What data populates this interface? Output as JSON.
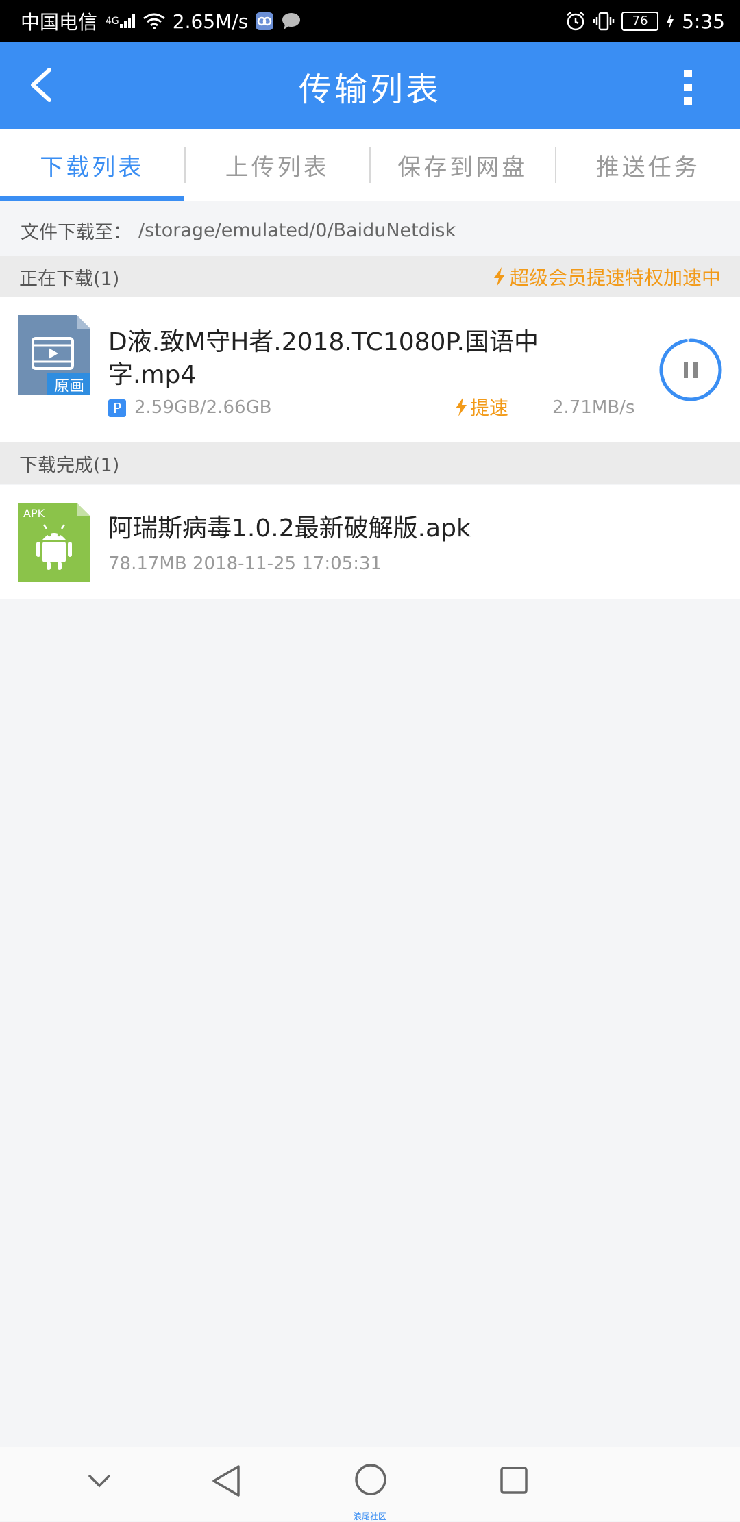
{
  "status_bar": {
    "carrier": "中国电信",
    "net_badge": "4G",
    "net_speed": "2.65M/s",
    "battery": "76",
    "time": "5:35"
  },
  "header": {
    "title": "传输列表"
  },
  "tabs": [
    {
      "label": "下载列表",
      "active": true
    },
    {
      "label": "上传列表",
      "active": false
    },
    {
      "label": "保存到网盘",
      "active": false
    },
    {
      "label": "推送任务",
      "active": false
    }
  ],
  "download_path": {
    "label": "文件下载至：",
    "path": "/storage/emulated/0/BaiduNetdisk"
  },
  "downloading": {
    "header": "正在下载(1)",
    "vip_text": "超级会员提速特权加速中",
    "items": [
      {
        "name_line1": "D液.致M守H者.2018.TC1080P.国语中",
        "name_line2": "字.mp4",
        "badge": "P",
        "progress": "2.59GB/2.66GB",
        "thumb_tag": "原画",
        "speedup_label": "提速",
        "speed": "2.71MB/s",
        "progress_fraction": 0.974
      }
    ]
  },
  "completed": {
    "header": "下载完成(1)",
    "items": [
      {
        "name": "阿瑞斯病毒1.0.2最新破解版.apk",
        "meta": "78.17MB 2018-11-25 17:05:31",
        "thumb_tag": "APK"
      }
    ]
  },
  "nav_bar": {
    "caption": "浪尾社区"
  },
  "colors": {
    "primary": "#3a8ef3",
    "accent": "#f29a18",
    "video_thumb": "#6f8fb3",
    "apk_thumb": "#8bc34a"
  },
  "icons": {
    "back": "chevron-left-icon",
    "more": "more-vertical-icon",
    "pause": "pause-icon",
    "bolt": "lightning-icon",
    "nav_down": "chevron-down-icon",
    "nav_back": "triangle-back-icon",
    "nav_home": "circle-home-icon",
    "nav_recent": "square-recent-icon"
  }
}
